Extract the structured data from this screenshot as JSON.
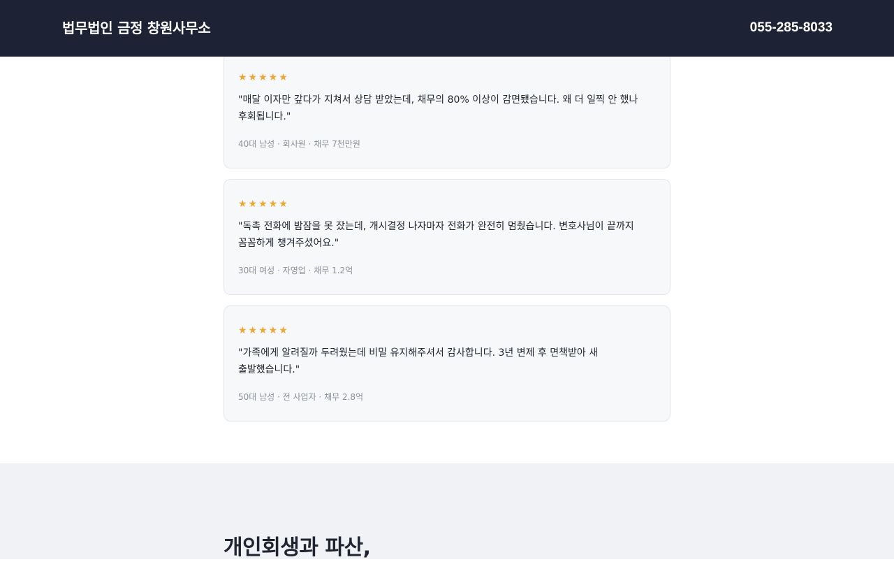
{
  "header": {
    "brand": "법무법인 금정 창원사무소",
    "phone": "055-285-8033"
  },
  "reviews": [
    {
      "stars": "★★★★★",
      "text": "\"매달 이자만 갚다가 지쳐서 상담 받았는데, 채무의 80% 이상이 감면됐습니다. 왜 더 일찍 안 했나 후회됩니다.\"",
      "meta": "40대 남성 · 회사원 · 채무 7천만원"
    },
    {
      "stars": "★★★★★",
      "text": "\"독촉 전화에 밤잠을 못 잤는데, 개시결정 나자마자 전화가 완전히 멈췄습니다. 변호사님이 끝까지 꼼꼼하게 챙겨주셨어요.\"",
      "meta": "30대 여성 · 자영업 · 채무 1.2억"
    },
    {
      "stars": "★★★★★",
      "text": "\"가족에게 알려질까 두려웠는데 비밀 유지해주셔서 감사합니다. 3년 변제 후 면책받아 새 출발했습니다.\"",
      "meta": "50대 남성 · 전 사업자 · 채무 2.8억"
    }
  ],
  "section": {
    "heading": "개인회생과 파산,"
  },
  "colors": {
    "header_bg": "#1e2235",
    "star": "#f0a531",
    "card_bg": "#f7f8fa",
    "section_bg": "#f1f2f5"
  }
}
